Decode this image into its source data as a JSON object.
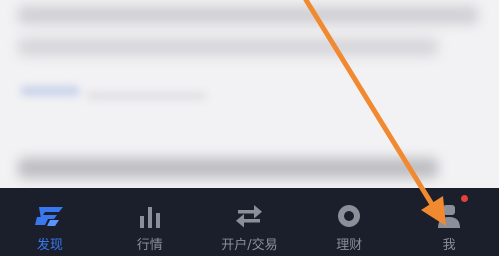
{
  "tabbar": {
    "tabs": [
      {
        "label": "发现",
        "icon": "discover-logo-icon",
        "active": true
      },
      {
        "label": "行情",
        "icon": "bar-chart-icon",
        "active": false
      },
      {
        "label": "开户/交易",
        "icon": "swap-arrows-icon",
        "active": false
      },
      {
        "label": "理财",
        "icon": "circle-icon",
        "active": false
      },
      {
        "label": "我",
        "icon": "person-icon",
        "active": false,
        "badge": true
      }
    ]
  },
  "colors": {
    "tabbar_bg": "#1a1f2b",
    "active": "#3a78f0",
    "inactive": "#8a8f99",
    "annotation_arrow": "#f0892f",
    "badge": "#e8403b"
  }
}
